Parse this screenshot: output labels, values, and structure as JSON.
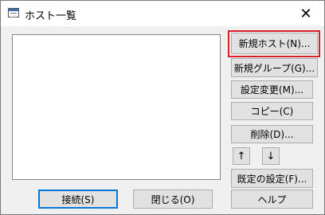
{
  "window": {
    "title": "ホスト一覧",
    "close_glyph": "✕"
  },
  "buttons": {
    "new_host": "新規ホスト(N)...",
    "new_group": "新規グループ(G)...",
    "change_settings": "設定変更(M)...",
    "copy": "コピー(C)",
    "delete": "削除(D)...",
    "move_up": "↑",
    "move_down": "↓",
    "default_settings": "既定の設定(F)...",
    "connect": "接続(S)",
    "close": "閉じる(O)",
    "help": "ヘルプ"
  },
  "icons": {
    "app": "window-app-icon",
    "close": "close-icon"
  },
  "colors": {
    "highlight": "#d9202a",
    "default_button": "#0078d7"
  }
}
